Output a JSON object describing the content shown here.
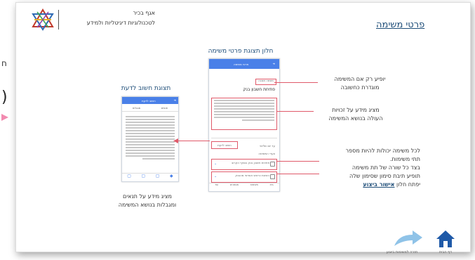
{
  "left_margin": {
    "mark1": "ח",
    "mark2": ")"
  },
  "header": {
    "title": "פרטי משימה",
    "org_line1": "אגף בכיר",
    "org_line2": "לטכנולוגיות דיגיטליות ולמידע"
  },
  "captions": {
    "task_window": "חלון תצוגת פרטי משימה",
    "important": "תצוגת חשוב לדעת",
    "important_desc_line1": "מציג מידע על תנאים",
    "important_desc_line2": "ומגבלות בנושא המשימה"
  },
  "annotations": {
    "critical_line1": "יופיע רק אם המשימה",
    "critical_line2": "מוגדרת כחשובה",
    "rights_line1": "מציג מידע על זכויות",
    "rights_line2": "העולה בנושא המשימה",
    "subtasks_line1": "לכל משימה יכולות להיות מספר",
    "subtasks_line2": "תתי משימות.",
    "subtasks_line3": "בצד כל שורה של תת משימה",
    "subtasks_line4": "תופיע תיבת סימון שסימון שלה",
    "subtasks_line5_pre": "יפתח חלון",
    "subtasks_link": "אישור ביצוע"
  },
  "phone_main": {
    "bar_title": "פרטי משימה",
    "critical_badge": "משימה חשובה",
    "task_title": "פתיחת חשבון בנק",
    "important_btn": "חשוב לדעת",
    "steps_label": "צעדי המשימה",
    "sub1": "פתיחת חשבון בנק בסניף הקרוב",
    "sub2": "הזמנת כרטיס אשראי מהבנק",
    "nav": [
      "בית",
      "משימות",
      "מסמכים",
      "עוד"
    ]
  },
  "phone_small": {
    "bar_title": "חשוב לדעת",
    "tab1": "תנאים",
    "tab2": "מגבלות"
  },
  "footer": {
    "home_label": "דף הבית",
    "back_label": "חזרה למשימות ביצוע"
  },
  "colors": {
    "accent": "#1f4e79",
    "phone_bar": "#4a80e8",
    "annotation": "#e05a6a",
    "home_icon": "#1f5aa8",
    "arrow": "#8fc3e8"
  }
}
